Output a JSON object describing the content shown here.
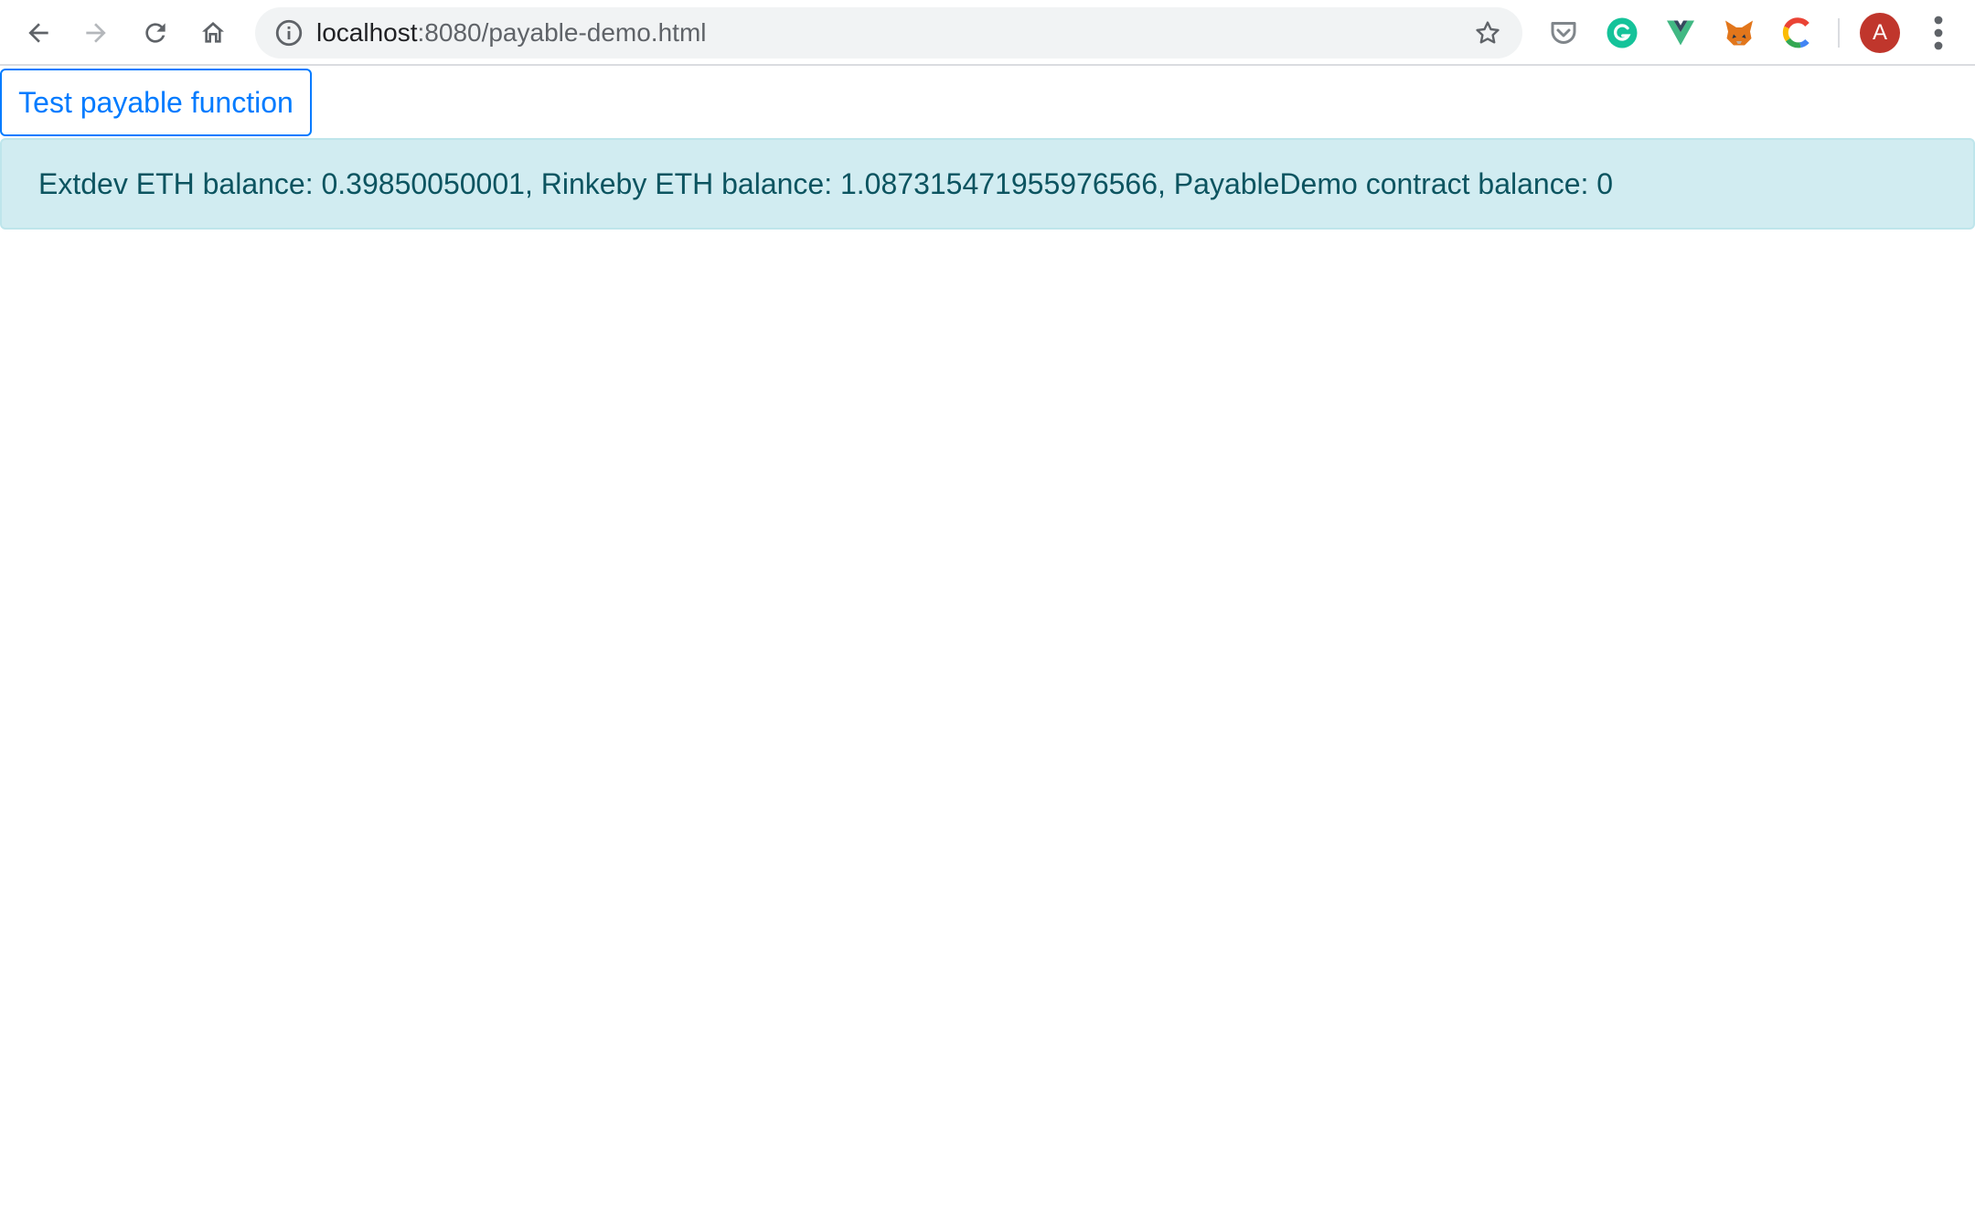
{
  "browser": {
    "url_host": "localhost",
    "url_rest": ":8080/payable-demo.html",
    "profile_initial": "A",
    "icons": {
      "back": "back-arrow-icon",
      "forward": "forward-arrow-icon",
      "reload": "reload-icon",
      "home": "home-icon",
      "site_info": "info-icon",
      "bookmark": "star-icon",
      "extensions": [
        "pocket-icon",
        "grammarly-icon",
        "vue-devtools-icon",
        "metamask-icon",
        "colorful-c-icon"
      ],
      "menu": "kebab-menu-icon"
    }
  },
  "page": {
    "test_button_label": "Test payable function",
    "balance_message": "Extdev ETH balance: 0.39850050001, Rinkeby ETH balance: 1.087315471955976566, PayableDemo contract balance: 0"
  },
  "colors": {
    "button_primary": "#007bff",
    "alert_bg": "#d1ecf1",
    "alert_border": "#bee5eb",
    "alert_text": "#0c5460",
    "avatar_bg": "#c0362c"
  }
}
